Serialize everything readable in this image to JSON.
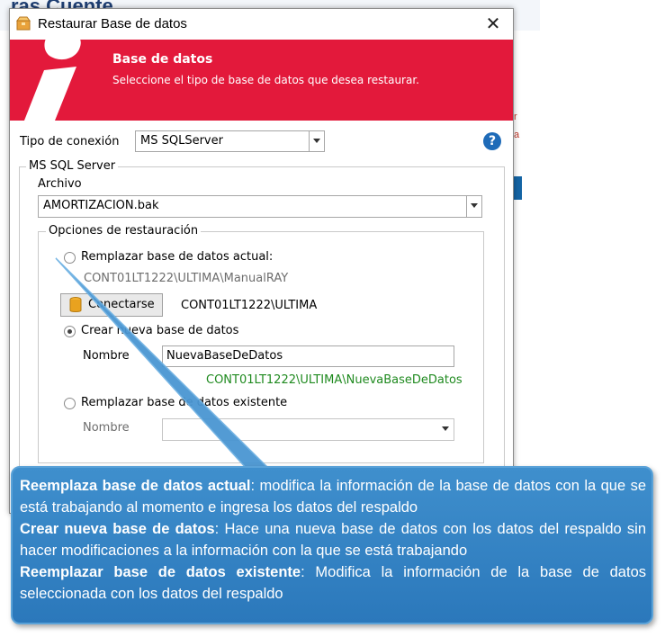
{
  "background": {
    "title": "ras Cuente",
    "side_text": "r\na"
  },
  "dialog": {
    "title": "Restaurar Base de datos",
    "banner": {
      "title": "Base de datos",
      "subtitle": "Seleccione el tipo de base de datos que desea restaurar."
    },
    "connection": {
      "label": "Tipo de conexión",
      "value": "MS SQLServer"
    },
    "help_glyph": "?",
    "group": {
      "legend": "MS SQL Server",
      "archivo_label": "Archivo",
      "archivo_value": "AMORTIZACION.bak",
      "options": {
        "legend": "Opciones de restauración",
        "replace_current": {
          "label": "Remplazar base de datos actual:",
          "path": "CONT01LT1222\\ULTIMA\\ManualRAY",
          "selected": false
        },
        "connect_button": {
          "label": "Conectarse",
          "server": "CONT01LT1222\\ULTIMA"
        },
        "create_new": {
          "label": "Crear nueva base de datos",
          "selected": true,
          "name_label": "Nombre",
          "name_value": "NuevaBaseDeDatos",
          "path": "CONT01LT1222\\ULTIMA\\NuevaBaseDeDatos"
        },
        "replace_existing": {
          "label": "Remplazar base de datos existente",
          "selected": false,
          "name_label": "Nombre",
          "name_value": ""
        }
      }
    },
    "close_glyph": "✕"
  },
  "callout": [
    {
      "bold": "Reemplaza base de datos actual",
      "text": ": modifica la información de la base de datos con la que se está trabajando al momento e ingresa los datos del respaldo"
    },
    {
      "bold": "Crear nueva base de datos",
      "text": ": Hace una nueva base de datos con los datos del respaldo sin hacer modificaciones a la información con la que se está trabajando"
    },
    {
      "bold": "Reemplazar base de datos existente",
      "text": ": Modifica la información de la base de datos seleccionada con los datos del respaldo"
    }
  ],
  "colors": {
    "banner": "#e3193b",
    "callout": "#3a87c8",
    "help": "#1e6bb8",
    "path_green": "#1f8a1f"
  }
}
